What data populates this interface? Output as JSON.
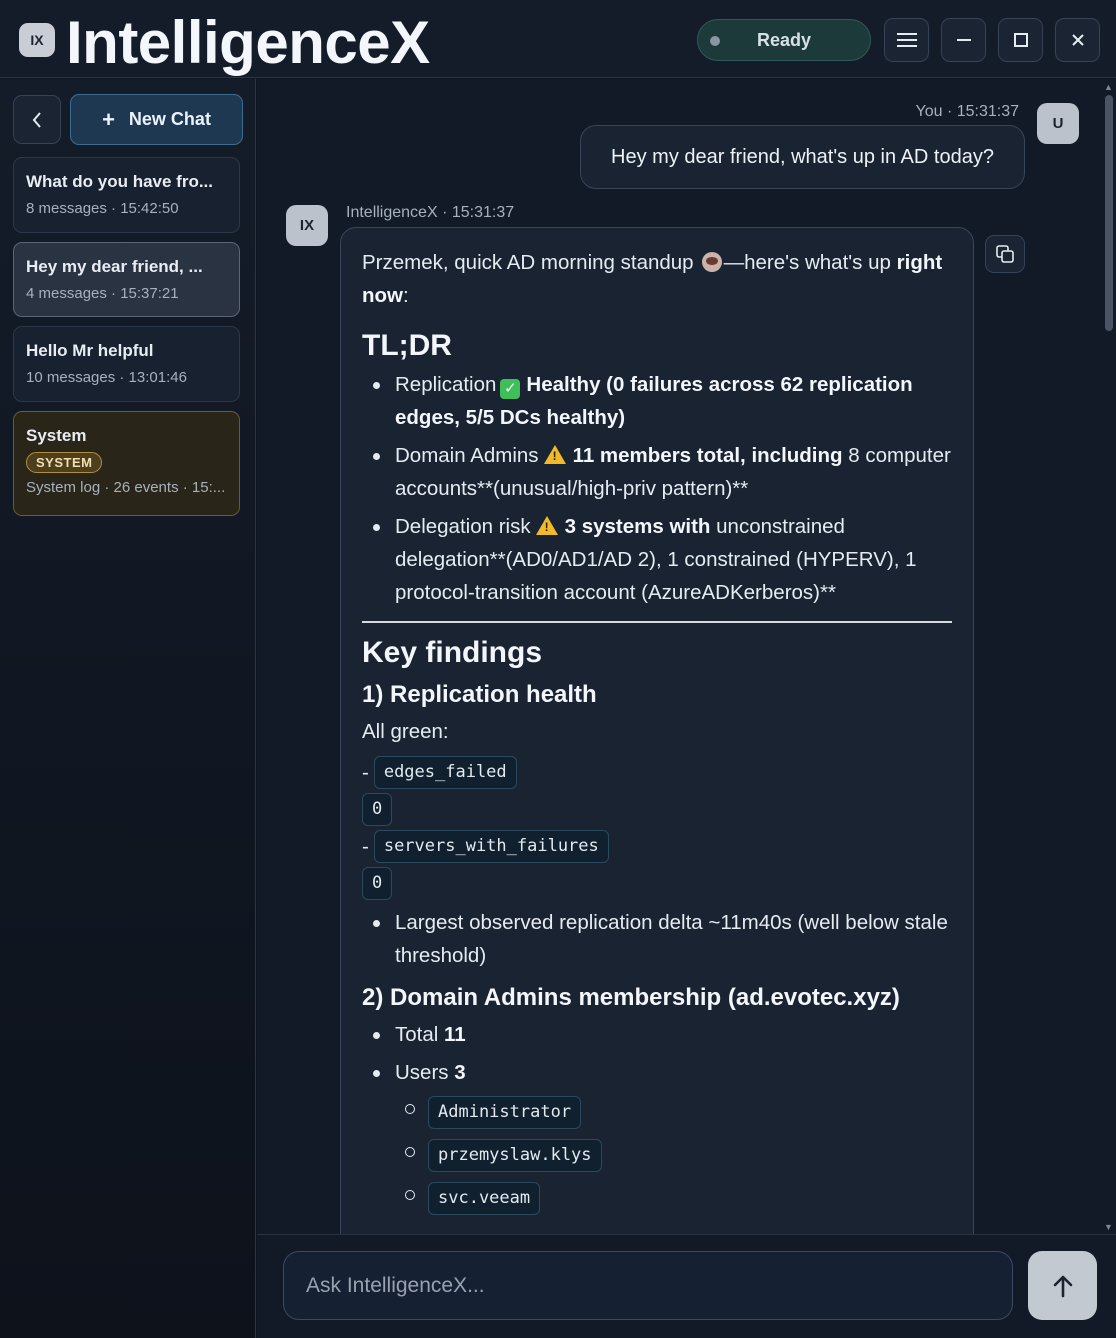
{
  "app": {
    "logo_text": "IX",
    "title": "IntelligenceX",
    "status": "Ready"
  },
  "sidebar": {
    "new_chat_label": "New Chat",
    "conversations": [
      {
        "title": "What do you have fro...",
        "meta": "8 messages · 15:42:50"
      },
      {
        "title": "Hey my dear friend, ...",
        "meta": "4 messages · 15:37:21"
      },
      {
        "title": "Hello Mr helpful",
        "meta": "10 messages · 13:01:46"
      },
      {
        "title": "System",
        "badge": "SYSTEM",
        "meta": "System log · 26 events · 15:..."
      }
    ]
  },
  "chat": {
    "user_meta": "You · 15:31:37",
    "user_avatar": "U",
    "user_message": "Hey my dear friend, what's up in AD today?",
    "ai_avatar": "IX",
    "ai_meta": "IntelligenceX · 15:31:37",
    "ai": {
      "intro_1": "Przemek, quick AD morning standup",
      "intro_2": "—here's what's up",
      "intro_bold": "right now",
      "intro_end": ":",
      "tldr_heading": "TL;DR",
      "tldr": [
        {
          "label": "Replication",
          "bold": "Healthy (0 failures across 62 replication edges, 5/5 DCs healthy)"
        },
        {
          "label": "Domain Admins",
          "bold": "11 members total, including",
          "rest": "8 computer accounts**(unusual/high-priv pattern)**"
        },
        {
          "label": "Delegation risk",
          "bold": "3 systems with",
          "rest": "unconstrained delegation**(AD0/AD1/AD 2), 1 constrained (HYPERV), 1 protocol-transition account (AzureADKerberos)**"
        }
      ],
      "key_heading": "Key findings",
      "rep_heading": "1) Replication health",
      "rep_intro": "All green:",
      "dash": "-",
      "code_1": "edges_failed",
      "code_1_val": "0",
      "code_2": "servers_with_failures",
      "code_2_val": "0",
      "rep_bullet": "Largest observed replication delta ~11m40s (well below stale threshold)",
      "da_heading": "2) Domain Admins membership (ad.evotec.xyz)",
      "da_total_label": "Total",
      "da_total": "11",
      "da_users_label": "Users",
      "da_users": "3",
      "users": [
        "Administrator",
        "przemyslaw.klys",
        "svc.veeam"
      ]
    }
  },
  "input": {
    "placeholder": "Ask IntelligenceX..."
  }
}
